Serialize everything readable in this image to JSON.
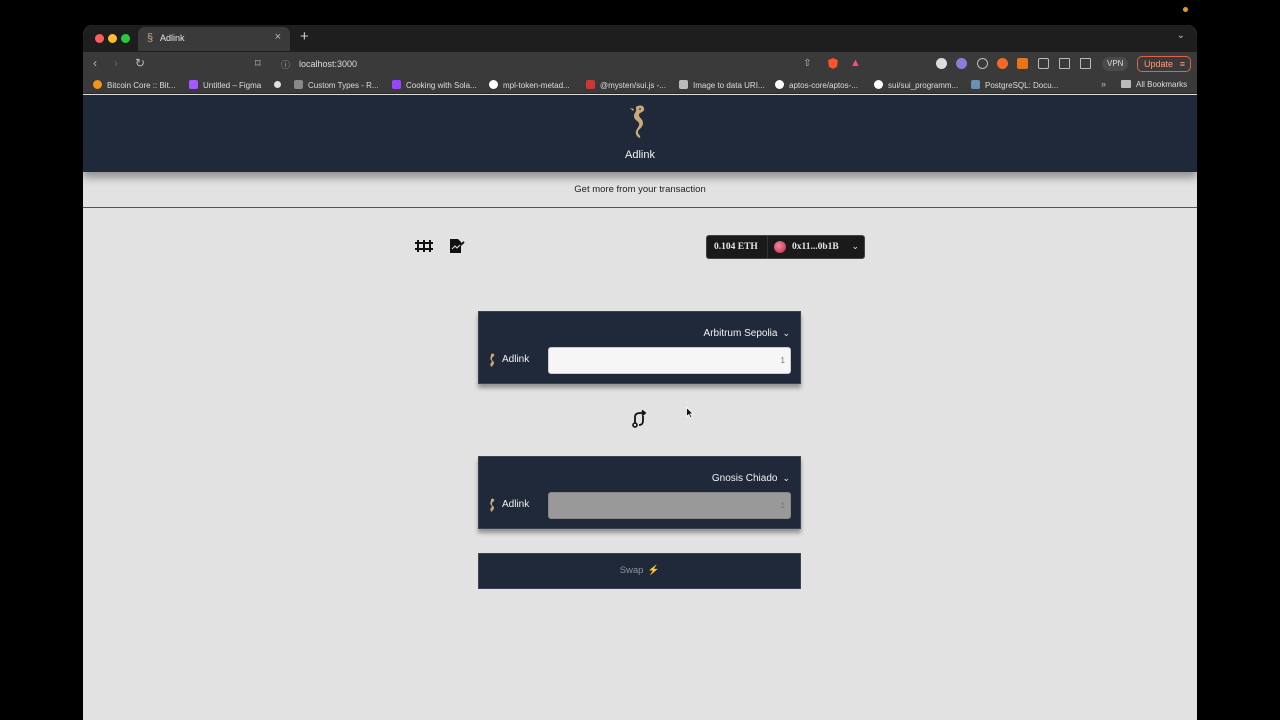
{
  "browser": {
    "tab_title": "Adlink",
    "url": "localhost:3000",
    "vpn_label": "VPN",
    "update_label": "Update",
    "bookmarks": [
      {
        "label": "Bitcoin Core :: Bit...",
        "color": "#f7931a"
      },
      {
        "label": "Untitled – Figma",
        "color": "#a259ff"
      },
      {
        "label": "",
        "color": "#e0e0e0"
      },
      {
        "label": "Custom Types - R...",
        "color": "#888888"
      },
      {
        "label": "Cooking with Sola...",
        "color": "#9945ff"
      },
      {
        "label": "mpl-token-metad...",
        "color": "#ffffff"
      },
      {
        "label": "@mysten/sui.js -...",
        "color": "#cb3837"
      },
      {
        "label": "Image to data URI...",
        "color": "#bbbbbb"
      },
      {
        "label": "aptos-core/aptos-...",
        "color": "#ffffff"
      },
      {
        "label": "sui/sui_programm...",
        "color": "#ffffff"
      },
      {
        "label": "PostgreSQL: Docu...",
        "color": "#6b8fb5"
      }
    ],
    "bookmarks_more": "»",
    "all_bookmarks": "All Bookmarks"
  },
  "header": {
    "brand": "Adlink",
    "tagline": "Get more from your transaction"
  },
  "wallet": {
    "balance": "0.104 ETH",
    "address": "0x11...0b1B"
  },
  "source": {
    "chain": "Arbitrum Sepolia",
    "token": "Adlink",
    "amount": "1"
  },
  "destination": {
    "chain": "Gnosis Chiado",
    "token": "Adlink",
    "amount": "1"
  },
  "swap": {
    "label": "Swap",
    "bolt": "⚡"
  },
  "colors": {
    "header_bg": "#1f2939",
    "page_bg": "#e2e2e2",
    "brand_accent": "#c8a97a"
  }
}
